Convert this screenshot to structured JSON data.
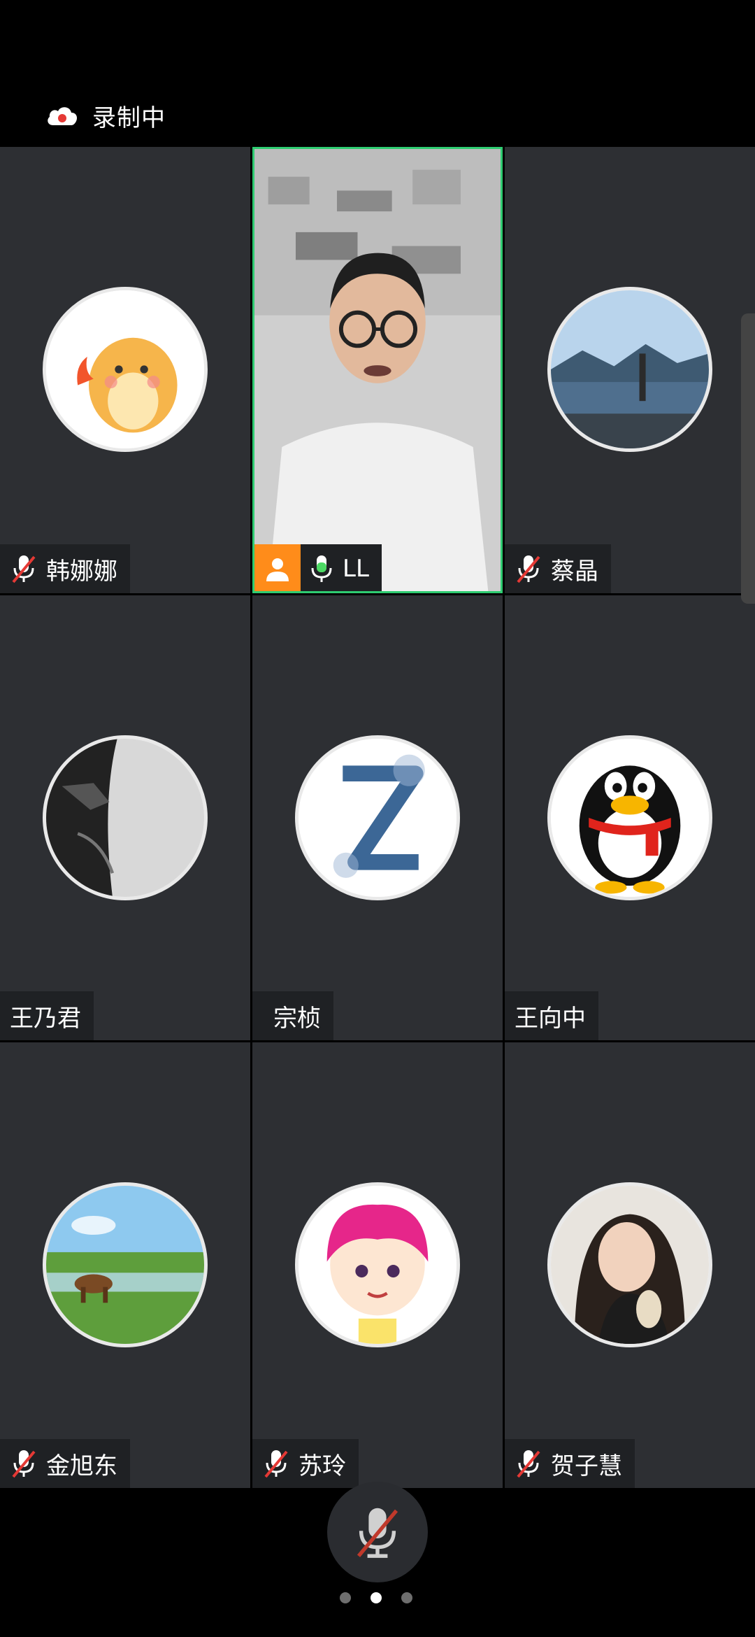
{
  "status_bar": {
    "recording_icon": "cloud-record-icon",
    "recording_label": "录制中"
  },
  "participants": [
    {
      "name": "韩娜娜",
      "mic": "muted",
      "avatar": "yellow-dino-avatar"
    },
    {
      "name": "LL",
      "mic": "active",
      "avatar": "camera-video",
      "host_icon": "person-icon"
    },
    {
      "name": "蔡晶",
      "mic": "muted",
      "avatar": "lake-landscape-avatar"
    },
    {
      "name": "王乃君",
      "mic": "none",
      "avatar": "batman-avatar"
    },
    {
      "name": "宗桢",
      "mic": "none",
      "avatar": "letter-z-avatar"
    },
    {
      "name": "王向中",
      "mic": "none",
      "avatar": "penguin-avatar"
    },
    {
      "name": "金旭东",
      "mic": "muted",
      "avatar": "meadow-deer-avatar"
    },
    {
      "name": "苏玲",
      "mic": "muted",
      "avatar": "cartoon-girl-avatar"
    },
    {
      "name": "贺子慧",
      "mic": "muted",
      "avatar": "girl-photo-avatar"
    }
  ],
  "bottom_bar": {
    "mic_button_icon": "mic-muted-icon",
    "page_count": 3,
    "current_page": 2
  },
  "colors": {
    "tile_bg": "#2d2f33",
    "name_bar_bg": "#1f2124",
    "speaker_border": "#2ecc71",
    "host_badge": "#ff8c1a",
    "mute_red": "#e53935",
    "mic_green": "#4cd964"
  }
}
